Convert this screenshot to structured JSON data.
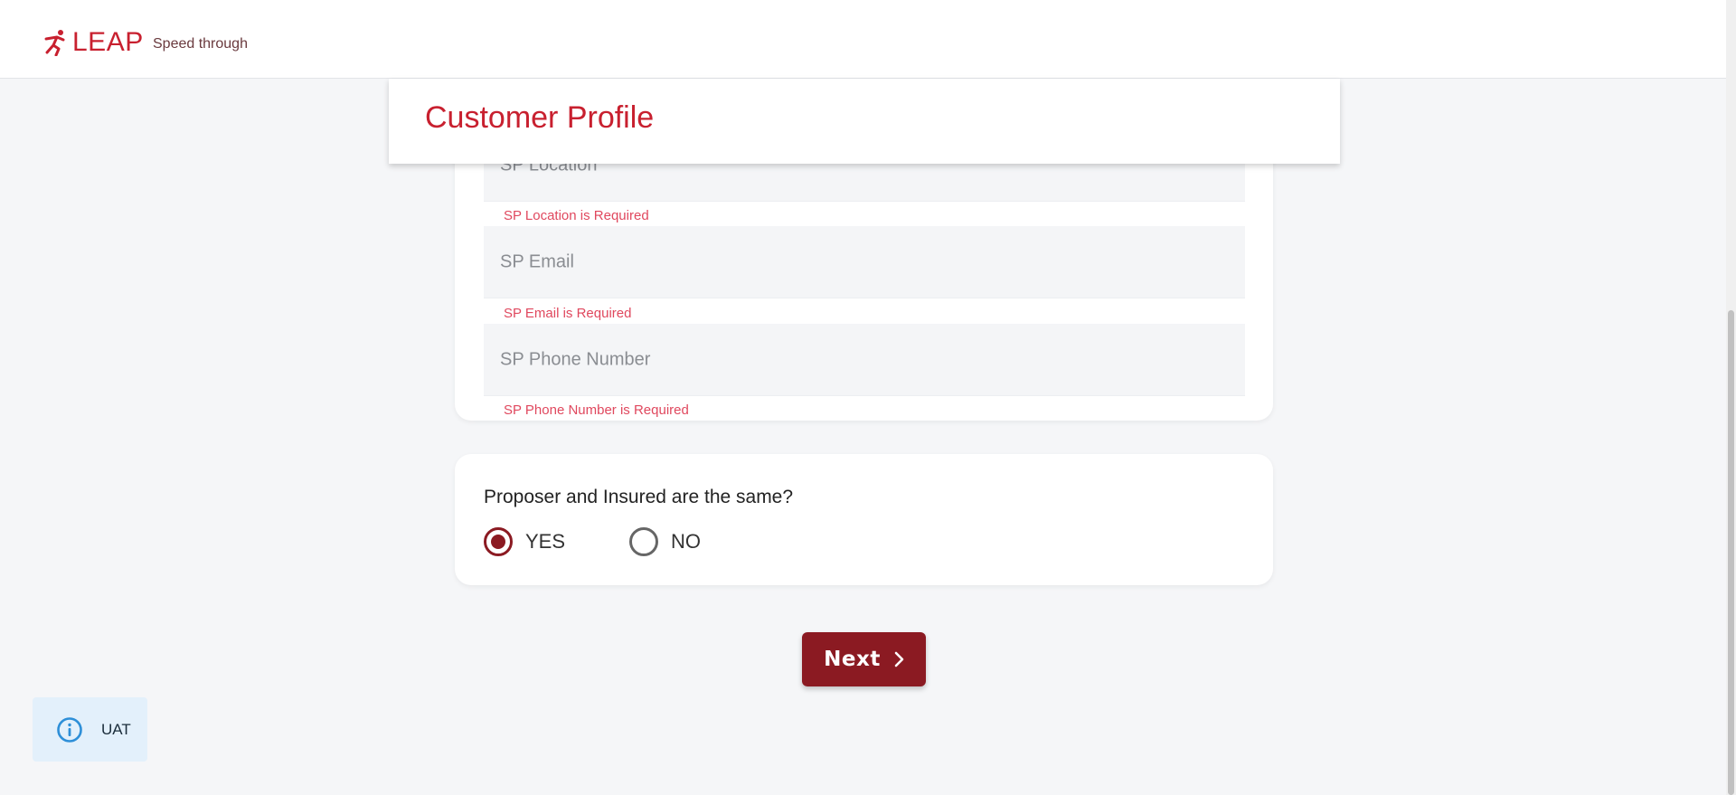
{
  "brand": {
    "name": "LEAP",
    "tagline": "Speed through"
  },
  "header": {
    "title": "Customer Profile"
  },
  "fields": [
    {
      "placeholder": "SP Location",
      "error": "SP Location is Required"
    },
    {
      "placeholder": "SP Email",
      "error": "SP Email is Required"
    },
    {
      "placeholder": "SP Phone Number",
      "error": "SP Phone Number is Required"
    }
  ],
  "question": {
    "text": "Proposer and Insured are the same?",
    "options": [
      {
        "label": "YES",
        "selected": true
      },
      {
        "label": "NO",
        "selected": false
      }
    ]
  },
  "actions": {
    "next_label": "Next"
  },
  "environment": {
    "label": "UAT",
    "icon": "info-icon"
  },
  "colors": {
    "brand_red": "#c8202f",
    "button_maroon": "#8b1a22",
    "error_pink": "#e0485e",
    "badge_bg": "#e3f0fb"
  }
}
